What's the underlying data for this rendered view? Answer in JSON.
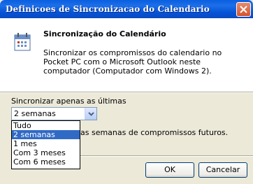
{
  "window": {
    "title": "Definicoes de Sincronizacao do Calendario"
  },
  "header": {
    "heading": "Sincronização do Calendário",
    "description": "Sincronizar os compromissos do calendario no Pocket PC com o Microsoft Outlook neste computador (Computador com Windows 2)."
  },
  "sync": {
    "label": "Sincronizar apenas as últimas",
    "selected": "2 semanas",
    "options": [
      "Tudo",
      "2 semanas",
      "1 mes",
      "Com 3 meses",
      "Com 6 meses"
    ],
    "info_fragment": "as semanas de compromissos futuros."
  },
  "buttons": {
    "ok": "OK",
    "cancel": "Cancelar"
  },
  "colors": {
    "titlebar": "#0a5fe0",
    "selection": "#316ac5",
    "dialog_bg": "#ece9d8"
  }
}
